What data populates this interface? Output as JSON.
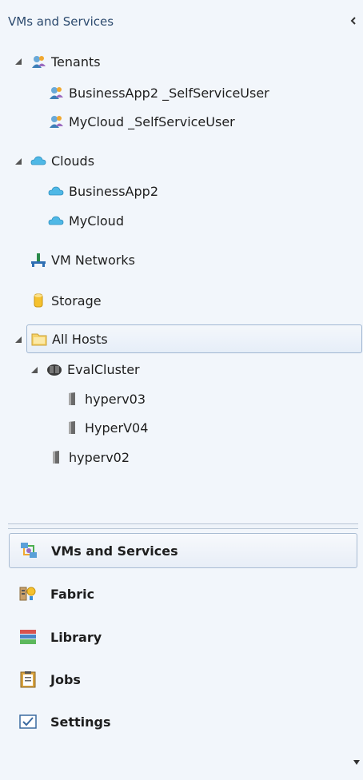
{
  "pane": {
    "title": "VMs and Services",
    "collapse_icon": "chevron-left-icon"
  },
  "tree": {
    "tenants": {
      "label": "Tenants",
      "children": [
        "BusinessApp2 _SelfServiceUser",
        "MyCloud _SelfServiceUser"
      ]
    },
    "clouds": {
      "label": "Clouds",
      "children": [
        "BusinessApp2",
        "MyCloud"
      ]
    },
    "vm_networks": {
      "label": "VM Networks"
    },
    "storage": {
      "label": "Storage"
    },
    "all_hosts": {
      "label": "All Hosts",
      "selected": true,
      "cluster": {
        "label": "EvalCluster",
        "children": [
          "hyperv03",
          "HyperV04"
        ]
      },
      "standalone": [
        "hyperv02"
      ]
    }
  },
  "workspaces": [
    {
      "label": "VMs and Services",
      "icon": "vms-services-icon",
      "selected": true
    },
    {
      "label": "Fabric",
      "icon": "fabric-icon",
      "selected": false
    },
    {
      "label": "Library",
      "icon": "library-icon",
      "selected": false
    },
    {
      "label": "Jobs",
      "icon": "jobs-icon",
      "selected": false
    },
    {
      "label": "Settings",
      "icon": "settings-icon",
      "selected": false
    }
  ],
  "colors": {
    "panel_bg": "#f2f6fb",
    "selection_border": "#9fb6d2",
    "cloud": "#4fb8e6"
  }
}
